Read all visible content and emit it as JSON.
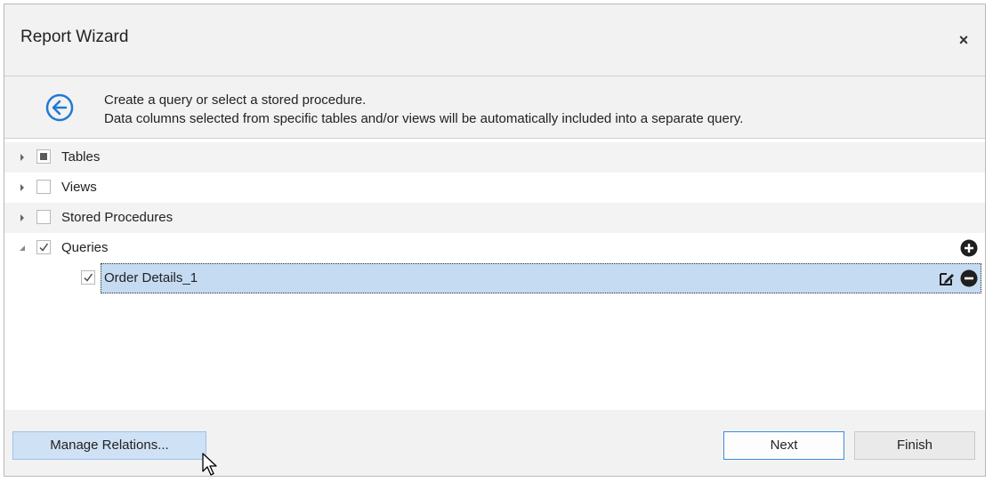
{
  "window": {
    "title": "Report Wizard",
    "close_label": "×"
  },
  "header": {
    "line1": "Create a query or select a stored procedure.",
    "line2": "Data columns selected from specific tables and/or views will be automatically included into a separate query."
  },
  "tree": {
    "tables": "Tables",
    "views": "Views",
    "stored_procedures": "Stored Procedures",
    "queries": "Queries",
    "query_item": "Order Details_1"
  },
  "buttons": {
    "manage": "Manage Relations...",
    "next": "Next",
    "finish": "Finish"
  },
  "colors": {
    "accent": "#1e7ad4",
    "selection": "#c5dbf2"
  },
  "icons": [
    "back-arrow-icon",
    "expand-arrow-icon",
    "collapse-arrow-icon",
    "add-circle-icon",
    "remove-circle-icon",
    "edit-query-icon",
    "mouse-cursor-icon"
  ]
}
